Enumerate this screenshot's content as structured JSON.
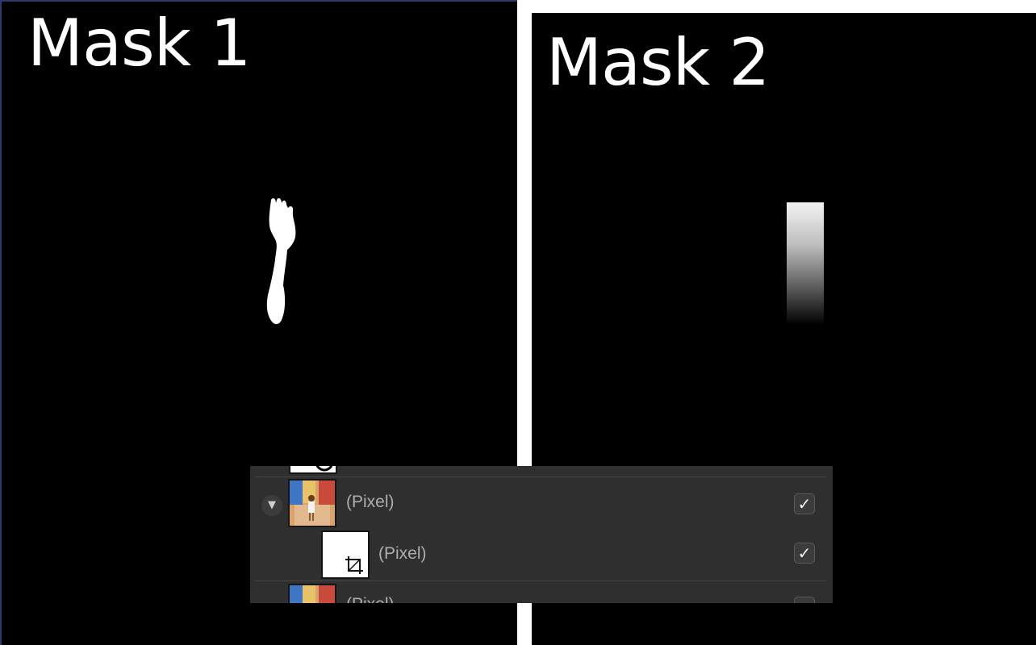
{
  "mask1": {
    "title": "Mask 1"
  },
  "mask2": {
    "title": "Mask 2"
  },
  "layers": {
    "rows": [
      {
        "label": "(Pixel)",
        "checked": true,
        "expander": "▼"
      },
      {
        "label": "(Pixel)",
        "checked": true
      },
      {
        "label": "(Pixel)",
        "checked": false
      }
    ],
    "check_glyph": "✓"
  },
  "icons": {
    "expand": "chevron-down-icon",
    "crop": "crop-icon",
    "check": "checkmark-icon"
  },
  "colors": {
    "panel_bg": "#2f2f2f",
    "label": "#aeaeae",
    "mask_bg": "#000000"
  }
}
